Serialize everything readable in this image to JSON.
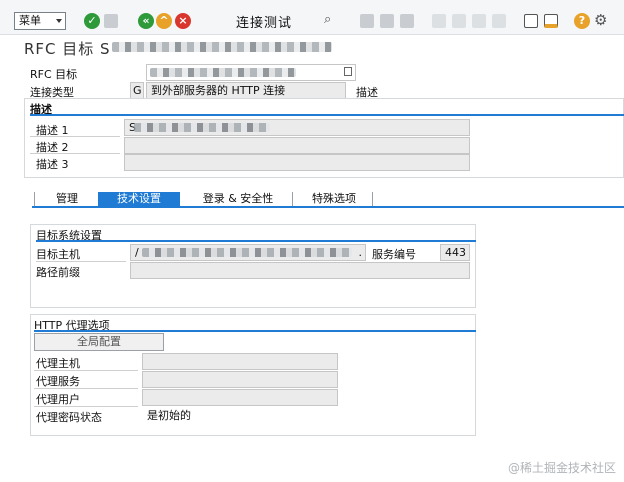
{
  "toolbar": {
    "menu_label": "菜单",
    "connection_test": "连接测试"
  },
  "header": {
    "title_prefix": "RFC 目标 S"
  },
  "top_form": {
    "rfc_target_label": "RFC 目标",
    "connection_type_label": "连接类型",
    "connection_type_code": "G",
    "connection_type_desc": "到外部服务器的 HTTP 连接",
    "desc_short_label": "描述"
  },
  "description": {
    "title": "描述",
    "rows": [
      {
        "label": "描述 1",
        "value": "S"
      },
      {
        "label": "描述 2",
        "value": ""
      },
      {
        "label": "描述 3",
        "value": ""
      }
    ]
  },
  "tabs": [
    {
      "label": "管理",
      "active": false
    },
    {
      "label": "技术设置",
      "active": true
    },
    {
      "label": "登录 & 安全性",
      "active": false
    },
    {
      "label": "特殊选项",
      "active": false
    }
  ],
  "target_system": {
    "title": "目标系统设置",
    "host_label": "目标主机",
    "host_value": "/",
    "host_suffix": ".",
    "service_label": "服务编号",
    "service_value": "443",
    "path_label": "路径前缀",
    "path_value": ""
  },
  "proxy": {
    "title": "HTTP 代理选项",
    "global_button": "全局配置",
    "rows": [
      {
        "label": "代理主机",
        "value": ""
      },
      {
        "label": "代理服务",
        "value": ""
      },
      {
        "label": "代理用户",
        "value": ""
      },
      {
        "label": "代理密码状态",
        "value": "是初始的"
      }
    ]
  },
  "watermark": "@稀土掘金技术社区"
}
